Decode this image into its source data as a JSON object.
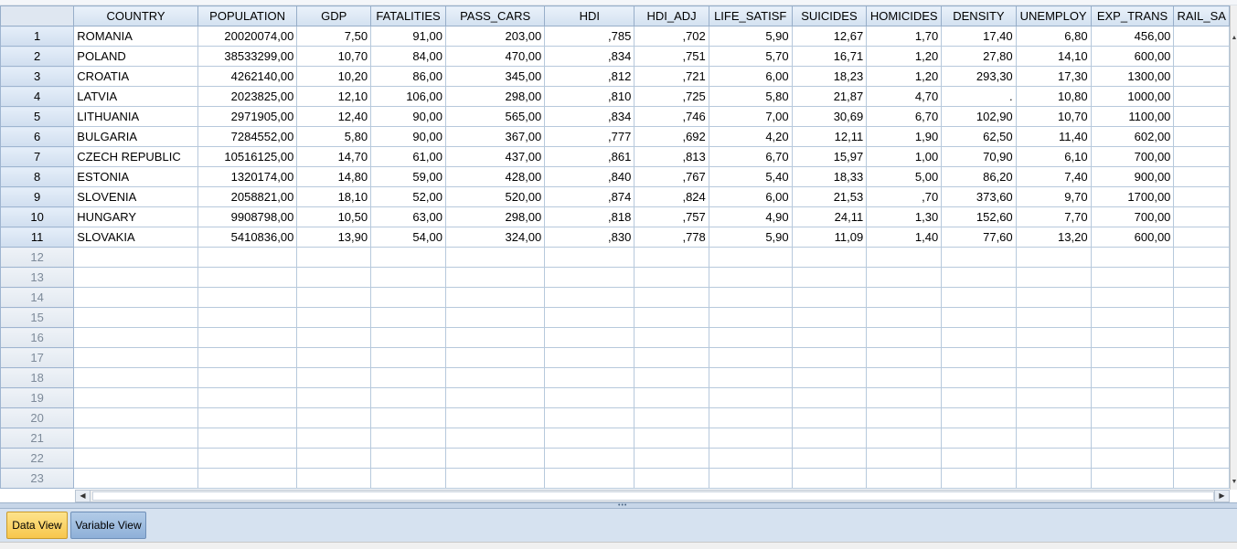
{
  "columns": [
    "COUNTRY",
    "POPULATION",
    "GDP",
    "FATALITIES",
    "PASS_CARS",
    "HDI",
    "HDI_ADJ",
    "LIFE_SATISF",
    "SUICIDES",
    "HOMICIDES",
    "DENSITY",
    "UNEMPLOY",
    "EXP_TRANS",
    "RAIL_SA"
  ],
  "rows": [
    {
      "num": "1",
      "cells": [
        "ROMANIA",
        "20020074,00",
        "7,50",
        "91,00",
        "203,00",
        ",785",
        ",702",
        "5,90",
        "12,67",
        "1,70",
        "17,40",
        "6,80",
        "456,00",
        ""
      ]
    },
    {
      "num": "2",
      "cells": [
        "POLAND",
        "38533299,00",
        "10,70",
        "84,00",
        "470,00",
        ",834",
        ",751",
        "5,70",
        "16,71",
        "1,20",
        "27,80",
        "14,10",
        "600,00",
        ""
      ]
    },
    {
      "num": "3",
      "cells": [
        "CROATIA",
        "4262140,00",
        "10,20",
        "86,00",
        "345,00",
        ",812",
        ",721",
        "6,00",
        "18,23",
        "1,20",
        "293,30",
        "17,30",
        "1300,00",
        ""
      ]
    },
    {
      "num": "4",
      "cells": [
        "LATVIA",
        "2023825,00",
        "12,10",
        "106,00",
        "298,00",
        ",810",
        ",725",
        "5,80",
        "21,87",
        "4,70",
        ".",
        "10,80",
        "1000,00",
        ""
      ]
    },
    {
      "num": "5",
      "cells": [
        "LITHUANIA",
        "2971905,00",
        "12,40",
        "90,00",
        "565,00",
        ",834",
        ",746",
        "7,00",
        "30,69",
        "6,70",
        "102,90",
        "10,70",
        "1100,00",
        ""
      ]
    },
    {
      "num": "6",
      "cells": [
        "BULGARIA",
        "7284552,00",
        "5,80",
        "90,00",
        "367,00",
        ",777",
        ",692",
        "4,20",
        "12,11",
        "1,90",
        "62,50",
        "11,40",
        "602,00",
        ""
      ]
    },
    {
      "num": "7",
      "cells": [
        "CZECH REPUBLIC",
        "10516125,00",
        "14,70",
        "61,00",
        "437,00",
        ",861",
        ",813",
        "6,70",
        "15,97",
        "1,00",
        "70,90",
        "6,10",
        "700,00",
        ""
      ]
    },
    {
      "num": "8",
      "cells": [
        "ESTONIA",
        "1320174,00",
        "14,80",
        "59,00",
        "428,00",
        ",840",
        ",767",
        "5,40",
        "18,33",
        "5,00",
        "86,20",
        "7,40",
        "900,00",
        ""
      ]
    },
    {
      "num": "9",
      "cells": [
        "SLOVENIA",
        "2058821,00",
        "18,10",
        "52,00",
        "520,00",
        ",874",
        ",824",
        "6,00",
        "21,53",
        ",70",
        "373,60",
        "9,70",
        "1700,00",
        ""
      ]
    },
    {
      "num": "10",
      "cells": [
        "HUNGARY",
        "9908798,00",
        "10,50",
        "63,00",
        "298,00",
        ",818",
        ",757",
        "4,90",
        "24,11",
        "1,30",
        "152,60",
        "7,70",
        "700,00",
        ""
      ]
    },
    {
      "num": "11",
      "cells": [
        "SLOVAKIA",
        "5410836,00",
        "13,90",
        "54,00",
        "324,00",
        ",830",
        ",778",
        "5,90",
        "11,09",
        "1,40",
        "77,60",
        "13,20",
        "600,00",
        ""
      ]
    },
    {
      "num": "12",
      "cells": [
        "",
        "",
        "",
        "",
        "",
        "",
        "",
        "",
        "",
        "",
        "",
        "",
        "",
        ""
      ]
    },
    {
      "num": "13",
      "cells": [
        "",
        "",
        "",
        "",
        "",
        "",
        "",
        "",
        "",
        "",
        "",
        "",
        "",
        ""
      ]
    },
    {
      "num": "14",
      "cells": [
        "",
        "",
        "",
        "",
        "",
        "",
        "",
        "",
        "",
        "",
        "",
        "",
        "",
        ""
      ]
    },
    {
      "num": "15",
      "cells": [
        "",
        "",
        "",
        "",
        "",
        "",
        "",
        "",
        "",
        "",
        "",
        "",
        "",
        ""
      ]
    },
    {
      "num": "16",
      "cells": [
        "",
        "",
        "",
        "",
        "",
        "",
        "",
        "",
        "",
        "",
        "",
        "",
        "",
        ""
      ]
    },
    {
      "num": "17",
      "cells": [
        "",
        "",
        "",
        "",
        "",
        "",
        "",
        "",
        "",
        "",
        "",
        "",
        "",
        ""
      ]
    },
    {
      "num": "18",
      "cells": [
        "",
        "",
        "",
        "",
        "",
        "",
        "",
        "",
        "",
        "",
        "",
        "",
        "",
        ""
      ]
    },
    {
      "num": "19",
      "cells": [
        "",
        "",
        "",
        "",
        "",
        "",
        "",
        "",
        "",
        "",
        "",
        "",
        "",
        ""
      ]
    },
    {
      "num": "20",
      "cells": [
        "",
        "",
        "",
        "",
        "",
        "",
        "",
        "",
        "",
        "",
        "",
        "",
        "",
        ""
      ]
    },
    {
      "num": "21",
      "cells": [
        "",
        "",
        "",
        "",
        "",
        "",
        "",
        "",
        "",
        "",
        "",
        "",
        "",
        ""
      ]
    },
    {
      "num": "22",
      "cells": [
        "",
        "",
        "",
        "",
        "",
        "",
        "",
        "",
        "",
        "",
        "",
        "",
        "",
        ""
      ]
    },
    {
      "num": "23",
      "cells": [
        "",
        "",
        "",
        "",
        "",
        "",
        "",
        "",
        "",
        "",
        "",
        "",
        "",
        ""
      ]
    }
  ],
  "tabs": {
    "data_view": "Data View",
    "variable_view": "Variable View"
  },
  "colors": {
    "active_tab": "#f7c74c",
    "inactive_tab": "#8eb0d8",
    "grid_line": "#b7c9dc"
  }
}
